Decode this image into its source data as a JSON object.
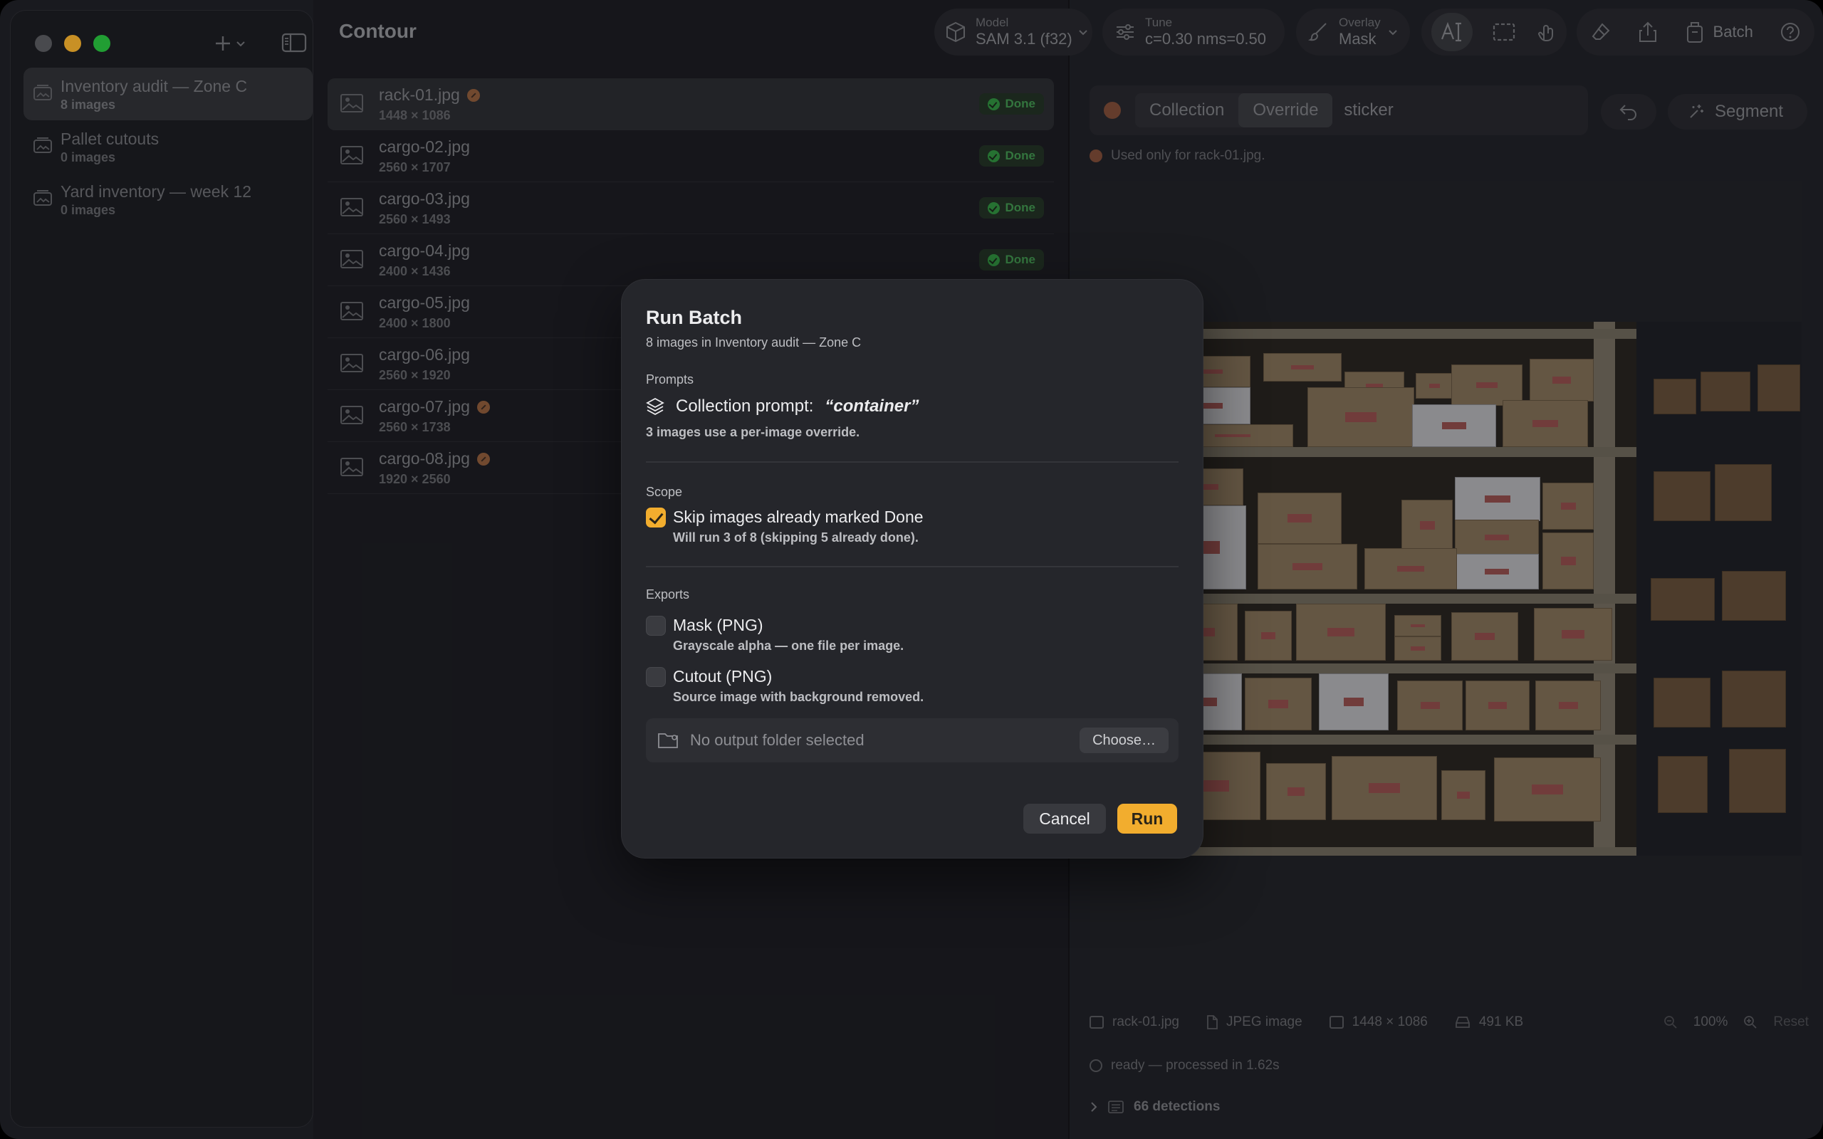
{
  "app": {
    "title": "Contour"
  },
  "sidebar": {
    "collections": [
      {
        "name": "Inventory audit — Zone C",
        "count": "8 images",
        "active": true
      },
      {
        "name": "Pallet cutouts",
        "count": "0 images",
        "active": false
      },
      {
        "name": "Yard inventory — week 12",
        "count": "0 images",
        "active": false
      }
    ]
  },
  "files": [
    {
      "name": "rack-01.jpg",
      "dims": "1448 × 1086",
      "override": true,
      "status": "Done"
    },
    {
      "name": "cargo-02.jpg",
      "dims": "2560 × 1707",
      "override": false,
      "status": "Done"
    },
    {
      "name": "cargo-03.jpg",
      "dims": "2560 × 1493",
      "override": false,
      "status": "Done"
    },
    {
      "name": "cargo-04.jpg",
      "dims": "2400 × 1436",
      "override": false,
      "status": "Done"
    },
    {
      "name": "cargo-05.jpg",
      "dims": "2400 × 1800",
      "override": false,
      "status": ""
    },
    {
      "name": "cargo-06.jpg",
      "dims": "2560 × 1920",
      "override": false,
      "status": ""
    },
    {
      "name": "cargo-07.jpg",
      "dims": "2560 × 1738",
      "override": true,
      "status": ""
    },
    {
      "name": "cargo-08.jpg",
      "dims": "1920 × 2560",
      "override": true,
      "status": ""
    }
  ],
  "toolbar": {
    "model_label": "Model",
    "model_value": "SAM 3.1 (f32)",
    "tune_label": "Tune",
    "tune_value": "c=0.30 nms=0.50",
    "overlay_label": "Overlay",
    "overlay_value": "Mask",
    "batch_label": "Batch"
  },
  "prompt_bar": {
    "mode_collection": "Collection",
    "mode_override": "Override",
    "selected_mode": "Override",
    "text": "sticker",
    "segment_label": "Segment",
    "used_note": "Used only for rack-01.jpg."
  },
  "info": {
    "filename": "rack-01.jpg",
    "type": "JPEG image",
    "dims": "1448 × 1086",
    "size": "491 KB",
    "zoom": "100%",
    "reset": "Reset",
    "status": "ready — processed in 1.62s",
    "detections": "66 detections"
  },
  "modal": {
    "title": "Run Batch",
    "subtitle": "8 images in Inventory audit — Zone C",
    "prompts_heading": "Prompts",
    "prompt_prefix": "Collection prompt:",
    "prompt_value": "“container”",
    "prompt_note": "3 images use a per-image override.",
    "scope_heading": "Scope",
    "skip_label": "Skip images already marked Done",
    "skip_checked": true,
    "skip_desc": "Will run 3 of 8 (skipping 5 already done).",
    "exports_heading": "Exports",
    "mask_label": "Mask (PNG)",
    "mask_checked": false,
    "mask_desc": "Grayscale alpha — one file per image.",
    "cutout_label": "Cutout (PNG)",
    "cutout_checked": false,
    "cutout_desc": "Source image with background removed.",
    "folder_placeholder": "No output folder selected",
    "choose_label": "Choose…",
    "cancel_label": "Cancel",
    "run_label": "Run"
  },
  "colors": {
    "accent": "#f2ad2e",
    "done": "#2f8c3e",
    "override": "#8a5a3a"
  }
}
